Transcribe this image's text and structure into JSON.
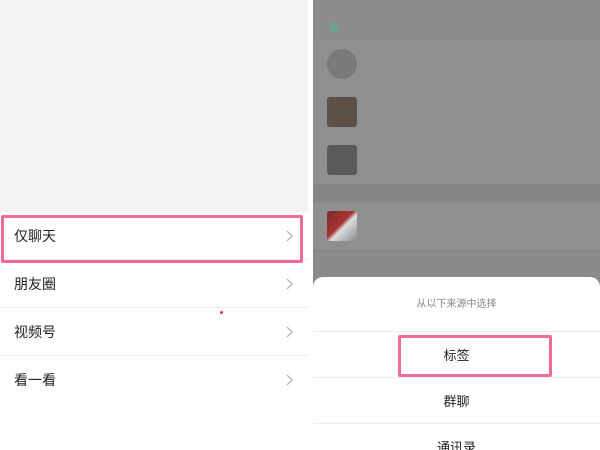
{
  "left_panel": {
    "menu_items": [
      {
        "label": "仅聊天"
      },
      {
        "label": "朋友圈"
      },
      {
        "label": "视频号"
      },
      {
        "label": "看一看"
      }
    ]
  },
  "right_panel": {
    "sheet": {
      "title": "从以下来源中选择",
      "options": [
        {
          "label": "标签"
        },
        {
          "label": "群聊"
        },
        {
          "label": "通讯录"
        }
      ]
    }
  },
  "colors": {
    "highlight": "#f26b9a",
    "overlay": "#8a8a8a"
  }
}
